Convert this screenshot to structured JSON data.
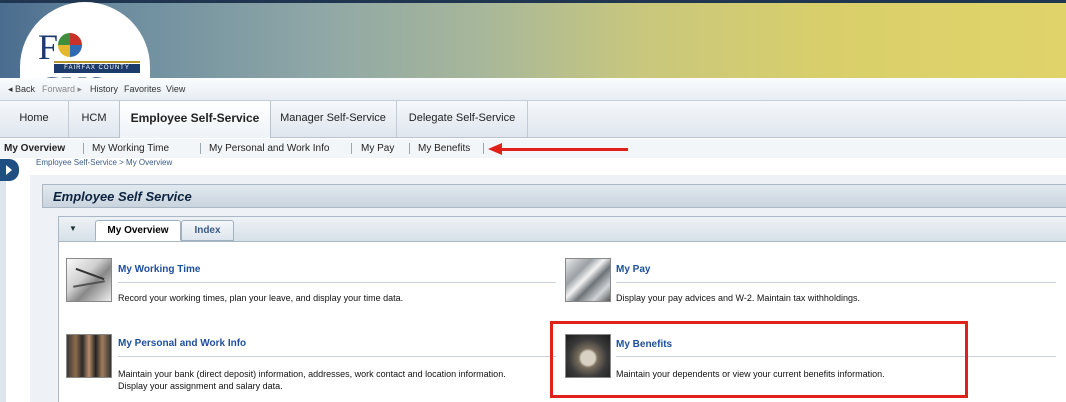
{
  "logo": {
    "text_pre": "F",
    "text_post": "CUS",
    "subtitle": "FAIRFAX COUNTY"
  },
  "history": {
    "back": "◂ Back",
    "forward": "Forward ▸",
    "history": "History",
    "favorites": "Favorites",
    "view": "View"
  },
  "top_tabs": [
    {
      "label": "Home"
    },
    {
      "label": "HCM"
    },
    {
      "label": "Employee Self-Service",
      "active": true
    },
    {
      "label": "Manager Self-Service"
    },
    {
      "label": "Delegate Self-Service"
    }
  ],
  "sub_nav": [
    {
      "label": "My Overview",
      "active": true
    },
    {
      "label": "My Working Time"
    },
    {
      "label": "My Personal and Work Info"
    },
    {
      "label": "My Pay"
    },
    {
      "label": "My Benefits"
    }
  ],
  "breadcrumb": "Employee Self-Service  >  My Overview",
  "panel_title": "Employee Self Service",
  "inner_tabs": {
    "caret": "▼",
    "overview": "My Overview",
    "index": "Index"
  },
  "tiles": {
    "working_time": {
      "title": "My Working Time",
      "desc": "Record your working times, plan your leave, and display your time data."
    },
    "pay": {
      "title": "My Pay",
      "desc": "Display your pay advices and W-2. Maintain tax withholdings."
    },
    "personal": {
      "title": "My Personal and Work Info",
      "desc1": "Maintain your bank (direct deposit) information, addresses, work contact and location information.",
      "desc2": "Display your assignment and salary data."
    },
    "benefits": {
      "title": "My Benefits",
      "desc": "Maintain your dependents or view your current benefits information."
    }
  },
  "annotation_color": "#e0201a"
}
